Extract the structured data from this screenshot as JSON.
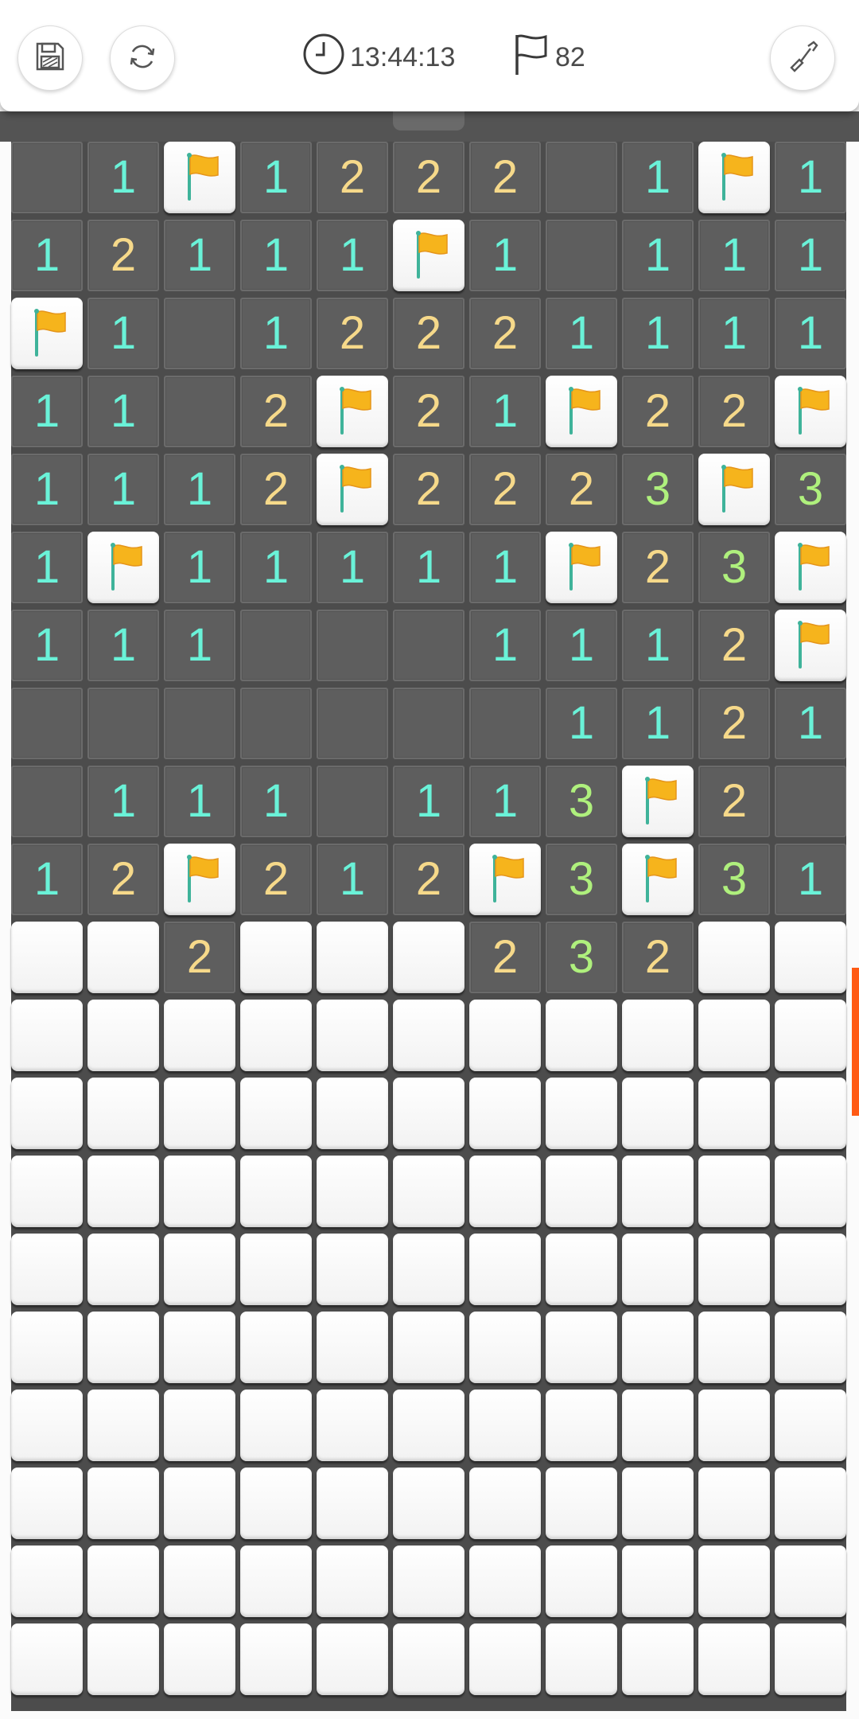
{
  "toolbar": {
    "save_icon": "save-icon",
    "restart_icon": "restart-icon",
    "timer_icon": "clock-icon",
    "timer": "13:44:13",
    "flags_icon": "flag-outline-icon",
    "flags_remaining": "82",
    "mode_icon": "shovel-icon"
  },
  "colors": {
    "num1": "#6af2d8",
    "num2": "#f6d98a",
    "num3": "#aff07d",
    "flag": "#f6b41c",
    "flagpole": "#3fb39a",
    "revealed": "#5e5e5e",
    "board": "#4c4c4c",
    "scroll_indicator": "#ff5a14"
  },
  "board": {
    "columns": 11,
    "legend": "0 = empty revealed, digits = count, F = flag, H = hidden",
    "rows": [
      "01F12220 1F1",
      "12111F10111",
      "F1012221111",
      "110 2F21F22F",
      "1112F2223F3",
      "1F1111 1F23F",
      "111000111 2F",
      "00000001121",
      "01110113F20",
      "12F212F3F31",
      "HH2HHH232HH",
      "HHHHHHHHHHH",
      "HHHHHHHHHHH",
      "HHHHHHHHHHH",
      "HHHHHHHHHHH",
      "HHHHHHHHHHH",
      "HHHHHHHHHHH",
      "HHHHHHHHHHH",
      "HHHHHHHHHHH",
      "HHHHHHHHHHH"
    ]
  }
}
